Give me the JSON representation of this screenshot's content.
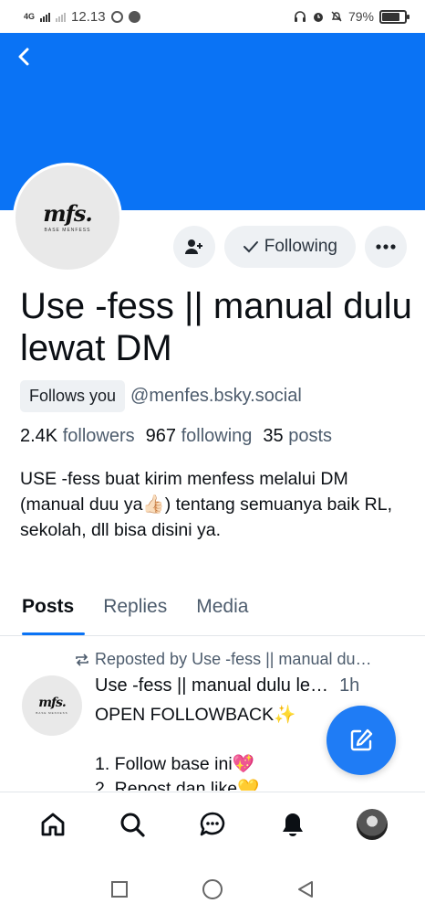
{
  "status_bar": {
    "network": "4G",
    "time": "12.13",
    "battery": "79%",
    "battery_level": 0.79
  },
  "profile": {
    "avatar_logo_text": "mfs.",
    "avatar_logo_sub": "BASE MENFESS",
    "following_label": "Following",
    "display_name": "Use -fess || manual dulu lewat DM",
    "follows_you_label": "Follows you",
    "handle": "@menfes.bsky.social",
    "followers_count": "2.4K",
    "followers_label": "followers",
    "following_count": "967",
    "following_stat_label": "following",
    "posts_count": "35",
    "posts_label": "posts",
    "bio": "USE -fess buat kirim menfess melalui DM (manual duu ya👍🏻) tentang semuanya baik RL, sekolah, dll bisa disini ya."
  },
  "tabs": [
    {
      "label": "Posts",
      "active": true
    },
    {
      "label": "Replies",
      "active": false
    },
    {
      "label": "Media",
      "active": false
    }
  ],
  "post": {
    "repost_label": "Reposted by Use -fess || manual du…",
    "author": "Use -fess || manual dulu le…",
    "time": "1h",
    "text": "OPEN FOLLOWBACK✨\n\n1. Follow base ini💖\n2. Repost dan like💛"
  },
  "colors": {
    "accent": "#0a73f5",
    "fab": "#1f7cf5",
    "muted_text": "#4d5c6d",
    "button_bg": "#eef1f4"
  },
  "icons": {
    "back": "chevron-left-icon",
    "add_user": "add-user-icon",
    "check": "check-icon",
    "more": "more-dots-icon",
    "repost": "repost-icon",
    "compose": "compose-icon",
    "home": "home-icon",
    "search": "search-icon",
    "chat": "chat-icon",
    "notifications": "bell-icon"
  }
}
